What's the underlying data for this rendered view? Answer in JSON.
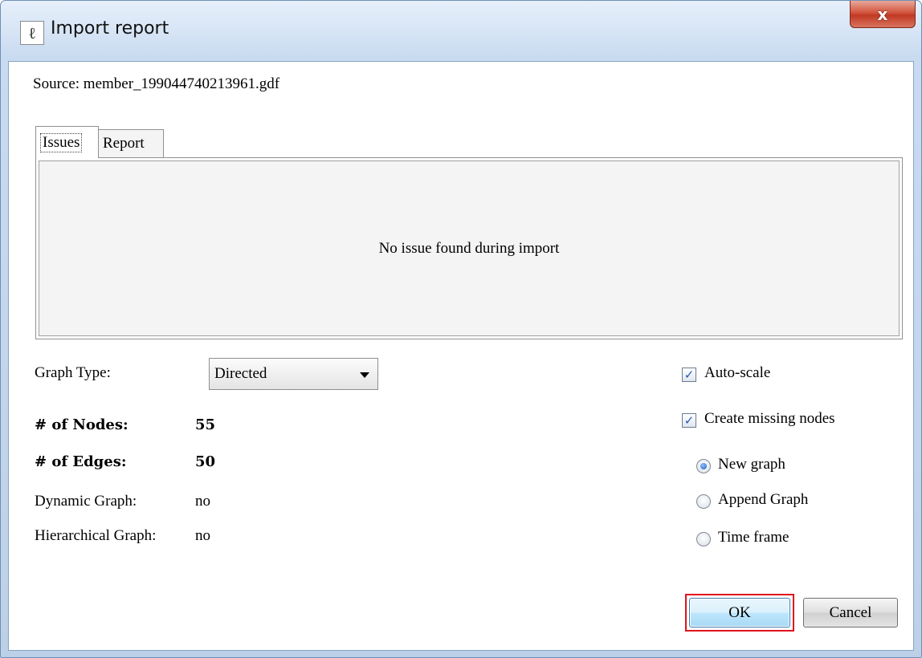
{
  "window": {
    "title": "Import report",
    "close_label": "x"
  },
  "source": {
    "label": "Source:",
    "file": "member_199044740213961.gdf"
  },
  "tabs": [
    {
      "label": "Issues",
      "active": true
    },
    {
      "label": "Report",
      "active": false
    }
  ],
  "issues_panel": {
    "message": "No issue found during import"
  },
  "graph_type": {
    "label": "Graph Type:",
    "selected": "Directed"
  },
  "stats": {
    "nodes_label": "# of Nodes:",
    "nodes_value": "55",
    "edges_label": "# of Edges:",
    "edges_value": "50",
    "dynamic_label": "Dynamic Graph:",
    "dynamic_value": "no",
    "hierarchical_label": "Hierarchical Graph:",
    "hierarchical_value": "no"
  },
  "options": {
    "auto_scale": {
      "label": "Auto-scale",
      "checked": true
    },
    "create_missing": {
      "label": "Create missing nodes",
      "checked": true
    },
    "radios": [
      {
        "label": "New graph",
        "checked": true
      },
      {
        "label": "Append Graph",
        "checked": false
      },
      {
        "label": "Time frame",
        "checked": false
      }
    ]
  },
  "buttons": {
    "ok": "OK",
    "cancel": "Cancel"
  },
  "colors": {
    "highlight": "#e0121b",
    "check_accent": "#2a55b8"
  }
}
